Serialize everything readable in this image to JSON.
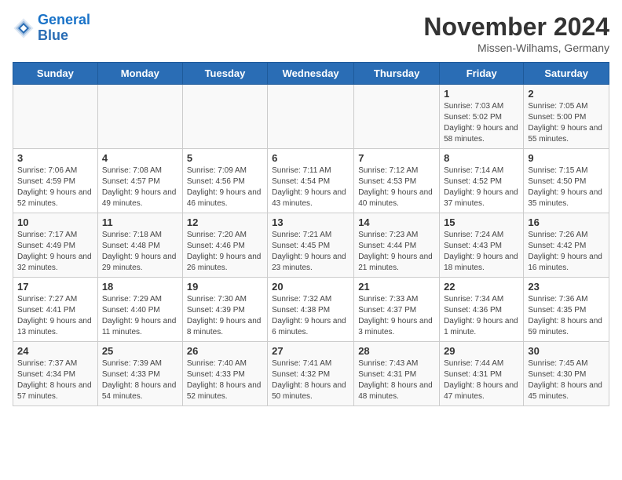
{
  "logo": {
    "line1": "General",
    "line2": "Blue"
  },
  "title": "November 2024",
  "subtitle": "Missen-Wilhams, Germany",
  "days_of_week": [
    "Sunday",
    "Monday",
    "Tuesday",
    "Wednesday",
    "Thursday",
    "Friday",
    "Saturday"
  ],
  "weeks": [
    [
      {
        "day": "",
        "info": ""
      },
      {
        "day": "",
        "info": ""
      },
      {
        "day": "",
        "info": ""
      },
      {
        "day": "",
        "info": ""
      },
      {
        "day": "",
        "info": ""
      },
      {
        "day": "1",
        "info": "Sunrise: 7:03 AM\nSunset: 5:02 PM\nDaylight: 9 hours and 58 minutes."
      },
      {
        "day": "2",
        "info": "Sunrise: 7:05 AM\nSunset: 5:00 PM\nDaylight: 9 hours and 55 minutes."
      }
    ],
    [
      {
        "day": "3",
        "info": "Sunrise: 7:06 AM\nSunset: 4:59 PM\nDaylight: 9 hours and 52 minutes."
      },
      {
        "day": "4",
        "info": "Sunrise: 7:08 AM\nSunset: 4:57 PM\nDaylight: 9 hours and 49 minutes."
      },
      {
        "day": "5",
        "info": "Sunrise: 7:09 AM\nSunset: 4:56 PM\nDaylight: 9 hours and 46 minutes."
      },
      {
        "day": "6",
        "info": "Sunrise: 7:11 AM\nSunset: 4:54 PM\nDaylight: 9 hours and 43 minutes."
      },
      {
        "day": "7",
        "info": "Sunrise: 7:12 AM\nSunset: 4:53 PM\nDaylight: 9 hours and 40 minutes."
      },
      {
        "day": "8",
        "info": "Sunrise: 7:14 AM\nSunset: 4:52 PM\nDaylight: 9 hours and 37 minutes."
      },
      {
        "day": "9",
        "info": "Sunrise: 7:15 AM\nSunset: 4:50 PM\nDaylight: 9 hours and 35 minutes."
      }
    ],
    [
      {
        "day": "10",
        "info": "Sunrise: 7:17 AM\nSunset: 4:49 PM\nDaylight: 9 hours and 32 minutes."
      },
      {
        "day": "11",
        "info": "Sunrise: 7:18 AM\nSunset: 4:48 PM\nDaylight: 9 hours and 29 minutes."
      },
      {
        "day": "12",
        "info": "Sunrise: 7:20 AM\nSunset: 4:46 PM\nDaylight: 9 hours and 26 minutes."
      },
      {
        "day": "13",
        "info": "Sunrise: 7:21 AM\nSunset: 4:45 PM\nDaylight: 9 hours and 23 minutes."
      },
      {
        "day": "14",
        "info": "Sunrise: 7:23 AM\nSunset: 4:44 PM\nDaylight: 9 hours and 21 minutes."
      },
      {
        "day": "15",
        "info": "Sunrise: 7:24 AM\nSunset: 4:43 PM\nDaylight: 9 hours and 18 minutes."
      },
      {
        "day": "16",
        "info": "Sunrise: 7:26 AM\nSunset: 4:42 PM\nDaylight: 9 hours and 16 minutes."
      }
    ],
    [
      {
        "day": "17",
        "info": "Sunrise: 7:27 AM\nSunset: 4:41 PM\nDaylight: 9 hours and 13 minutes."
      },
      {
        "day": "18",
        "info": "Sunrise: 7:29 AM\nSunset: 4:40 PM\nDaylight: 9 hours and 11 minutes."
      },
      {
        "day": "19",
        "info": "Sunrise: 7:30 AM\nSunset: 4:39 PM\nDaylight: 9 hours and 8 minutes."
      },
      {
        "day": "20",
        "info": "Sunrise: 7:32 AM\nSunset: 4:38 PM\nDaylight: 9 hours and 6 minutes."
      },
      {
        "day": "21",
        "info": "Sunrise: 7:33 AM\nSunset: 4:37 PM\nDaylight: 9 hours and 3 minutes."
      },
      {
        "day": "22",
        "info": "Sunrise: 7:34 AM\nSunset: 4:36 PM\nDaylight: 9 hours and 1 minute."
      },
      {
        "day": "23",
        "info": "Sunrise: 7:36 AM\nSunset: 4:35 PM\nDaylight: 8 hours and 59 minutes."
      }
    ],
    [
      {
        "day": "24",
        "info": "Sunrise: 7:37 AM\nSunset: 4:34 PM\nDaylight: 8 hours and 57 minutes."
      },
      {
        "day": "25",
        "info": "Sunrise: 7:39 AM\nSunset: 4:33 PM\nDaylight: 8 hours and 54 minutes."
      },
      {
        "day": "26",
        "info": "Sunrise: 7:40 AM\nSunset: 4:33 PM\nDaylight: 8 hours and 52 minutes."
      },
      {
        "day": "27",
        "info": "Sunrise: 7:41 AM\nSunset: 4:32 PM\nDaylight: 8 hours and 50 minutes."
      },
      {
        "day": "28",
        "info": "Sunrise: 7:43 AM\nSunset: 4:31 PM\nDaylight: 8 hours and 48 minutes."
      },
      {
        "day": "29",
        "info": "Sunrise: 7:44 AM\nSunset: 4:31 PM\nDaylight: 8 hours and 47 minutes."
      },
      {
        "day": "30",
        "info": "Sunrise: 7:45 AM\nSunset: 4:30 PM\nDaylight: 8 hours and 45 minutes."
      }
    ]
  ]
}
